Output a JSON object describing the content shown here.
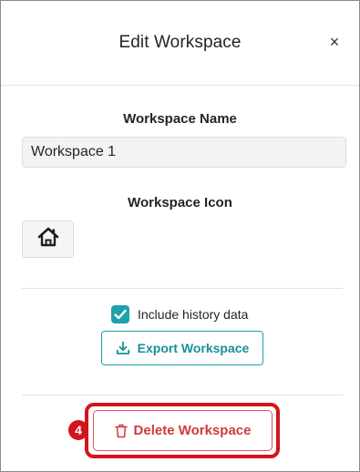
{
  "dialog": {
    "title": "Edit Workspace",
    "close_label": "×"
  },
  "workspace_name": {
    "label": "Workspace Name",
    "value": "Workspace 1"
  },
  "workspace_icon": {
    "label": "Workspace Icon",
    "icon": "house-icon"
  },
  "history": {
    "checked": true,
    "label": "Include history data"
  },
  "export": {
    "label": "Export Workspace",
    "icon": "download-icon"
  },
  "delete": {
    "label": "Delete Workspace",
    "icon": "trash-icon"
  },
  "annotation": {
    "step": "4",
    "color": "#d4141c"
  },
  "colors": {
    "accent": "#20a0ad",
    "danger": "#d03a3a"
  }
}
